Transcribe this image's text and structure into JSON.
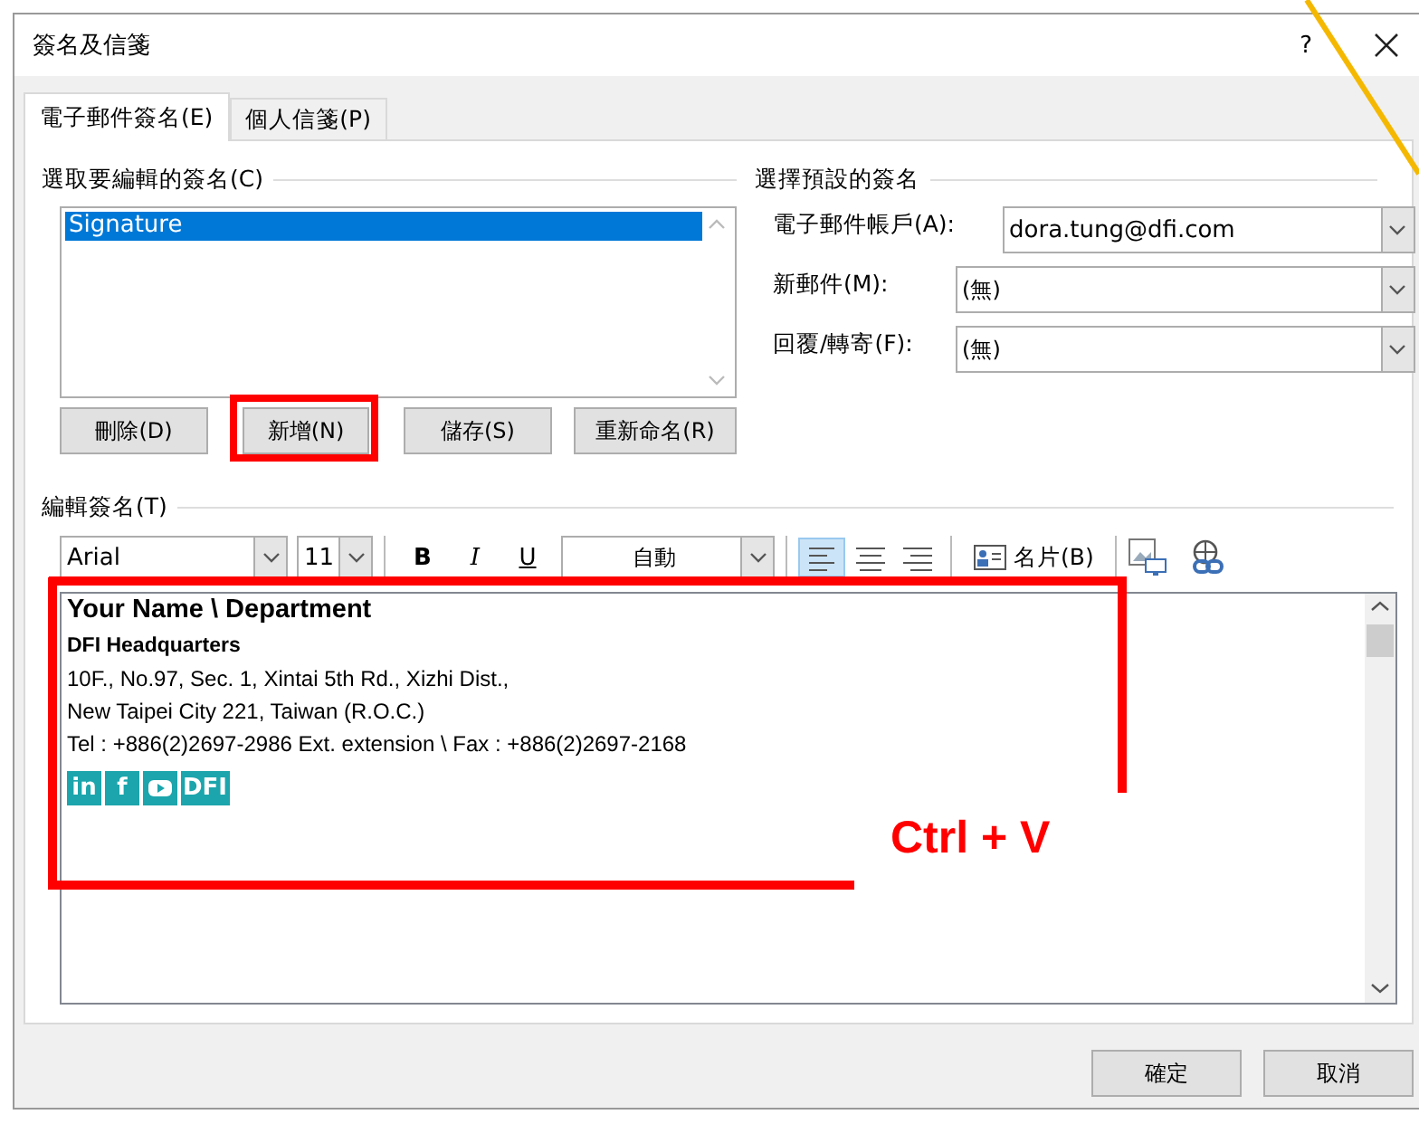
{
  "window": {
    "title": "簽名及信箋",
    "help": "?"
  },
  "tabs": [
    {
      "label": "電子郵件簽名(E)",
      "selected": true
    },
    {
      "label": "個人信箋(P)",
      "selected": false
    }
  ],
  "select_signature": {
    "heading": "選取要編輯的簽名(C)",
    "items": [
      {
        "label": "Signature",
        "selected": true
      }
    ],
    "buttons": [
      "刪除(D)",
      "新增(N)",
      "儲存(S)",
      "重新命名(R)"
    ]
  },
  "default_signature": {
    "heading": "選擇預設的簽名",
    "fields": [
      {
        "label": "電子郵件帳戶(A):",
        "value": "dora.tung@dfi.com"
      },
      {
        "label": "新郵件(M):",
        "value": "(無)"
      },
      {
        "label": "回覆/轉寄(F):",
        "value": "(無)"
      }
    ]
  },
  "edit_signature": {
    "heading": "編輯簽名(T)",
    "toolbar": {
      "font": "Arial",
      "size": "11",
      "bold": "B",
      "italic": "I",
      "underline": "U",
      "text_color_label": "自動",
      "alignment": [
        {
          "kind": "left",
          "selected": true
        },
        {
          "kind": "center",
          "selected": false
        },
        {
          "kind": "right",
          "selected": false
        }
      ],
      "business_card": "名片(B)"
    },
    "lines": [
      {
        "kind": "title",
        "text": "Your Name \\ Department"
      },
      {
        "kind": "subtitle",
        "text": "DFI Headquarters"
      },
      {
        "kind": "plain",
        "text": "10F., No.97, Sec. 1, Xintai 5th Rd., Xizhi Dist.,"
      },
      {
        "kind": "plain",
        "text": "New Taipei City 221, Taiwan (R.O.C.)"
      },
      {
        "kind": "plain",
        "text": "Tel : +886(2)2697-2986 Ext. extension \\ Fax : +886(2)2697-2168"
      }
    ],
    "social_links": [
      {
        "kind": "text",
        "label": "in"
      },
      {
        "kind": "text",
        "label": "f"
      },
      {
        "kind": "play"
      },
      {
        "kind": "text",
        "label": "DFI"
      }
    ]
  },
  "footer_buttons": [
    "確定",
    "取消"
  ],
  "annotation": {
    "callout": "Ctrl + V"
  }
}
